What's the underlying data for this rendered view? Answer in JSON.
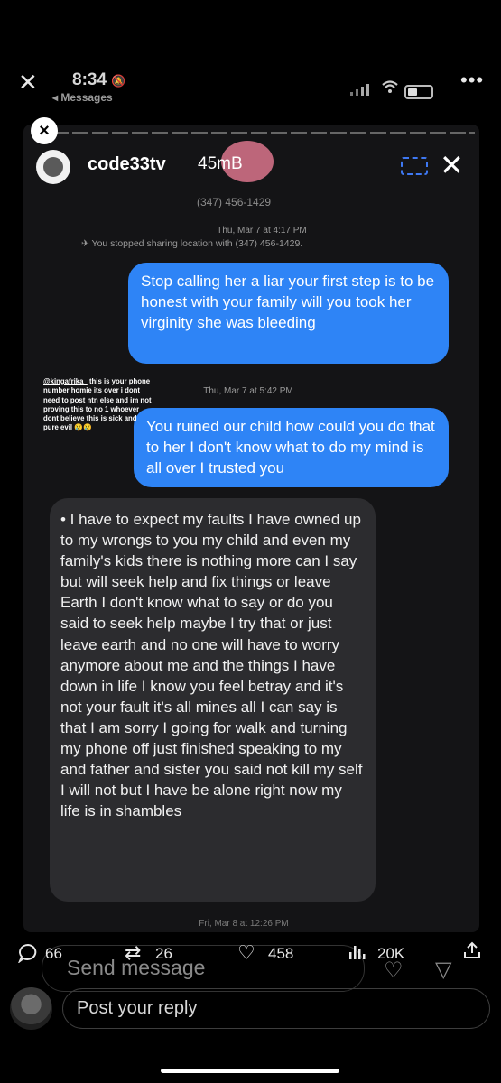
{
  "status": {
    "close_glyph": "✕",
    "time": "8:34",
    "mute_glyph": "🔕",
    "back_label": "◂ Messages",
    "more_glyph": "•••",
    "wifi_glyph": "((·"
  },
  "story": {
    "close_glyph": "×",
    "username": "code33tv",
    "size": "45mB",
    "x_glyph": "✕",
    "contact_phone": "(347) 456-1429",
    "thread": {
      "timestamp_1": "Thu, Mar 7 at 4:17 PM",
      "location_note": "✈ You stopped sharing location with (347) 456-1429.",
      "sent_1": "Stop calling her a liar your first step is to be honest with your family will you took her virginity she was bleeding",
      "timestamp_2": "Thu, Mar 7 at 5:42 PM",
      "sent_2": "You ruined our child how could you do that to her I don't know what to do my mind is all over I trusted you",
      "received_1": "•   I have to expect my faults I have owned up to my wrongs to you my child and even my family's kids there is nothing more can I say but will  seek help and fix things or leave Earth I don't know what to say or do you said to seek help maybe I try that or just leave earth and no one will have to worry anymore  about me and the things I have down in life I know you feel betray and it's not your fault it's all mines all  I can say is that I am sorry I going for walk and turning my phone off just finished speaking to my and father and sister you said not kill my self I will not but I have be alone right now my life is in shambles",
      "timestamp_3": "Fri, Mar 8 at 12:26 PM"
    },
    "overlay_caption": {
      "mention": "@kingafrika_",
      "text": " this is your phone number homie its over i dont need to post ntn else and im not proving this to no 1 whoever dont believe this is sick and pure evil 😢😢"
    },
    "send_placeholder": "Send message"
  },
  "engagement": {
    "replies": "66",
    "reposts": "26",
    "likes": "458",
    "views": "20K"
  },
  "reply_bar": {
    "placeholder": "Post your reply"
  },
  "colors": {
    "sent_bubble": "#2e84f6",
    "received_bubble": "#2c2c2f",
    "background": "#000000"
  }
}
